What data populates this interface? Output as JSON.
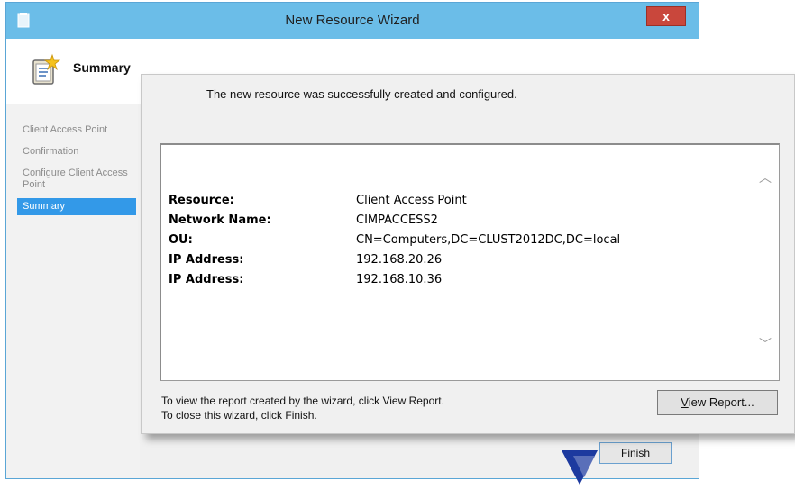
{
  "window": {
    "title": "New Resource Wizard",
    "close_label": "x",
    "header_title": "Summary"
  },
  "sidebar": {
    "steps": [
      {
        "label": "Client Access Point"
      },
      {
        "label": "Confirmation"
      },
      {
        "label": "Configure Client Access Point"
      },
      {
        "label": "Summary",
        "active": true
      }
    ]
  },
  "panel": {
    "success_message": "The new resource was successfully created and configured.",
    "report_rows": [
      {
        "key": "Resource:",
        "value": "Client Access Point"
      },
      {
        "key": "Network Name:",
        "value": "CIMPACCESS2"
      },
      {
        "key": "OU:",
        "value": "CN=Computers,DC=CLUST2012DC,DC=local"
      },
      {
        "key": "IP Address:",
        "value": "192.168.20.26"
      },
      {
        "key": "IP Address:",
        "value": "192.168.10.36"
      }
    ],
    "footer_line1": "To view the report created by the wizard, click View Report.",
    "footer_line2": "To close this wizard, click Finish.",
    "view_report_label": "View Report..."
  },
  "buttons": {
    "finish_label": "Finish"
  },
  "colors": {
    "titlebar": "#6bbde8",
    "active_step": "#3399e8",
    "close_button": "#c9473c",
    "arrow": "#1d3a9f"
  }
}
